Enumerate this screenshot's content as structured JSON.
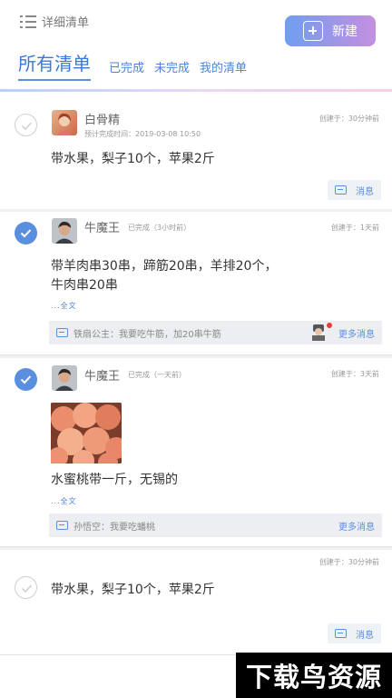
{
  "header": {
    "detail_label": "详细清单",
    "new_button_label": "新建",
    "tabs": [
      "所有清单",
      "已完成",
      "未完成",
      "我的清单"
    ]
  },
  "cards": [
    {
      "name": "白骨精",
      "status": "预计完成时间：2019-03-08 10:50",
      "created": "创建于：30分钟前",
      "content": "带水果，梨子10个，苹果2斤",
      "message_label": "消息",
      "checked": false
    },
    {
      "name": "牛魔王",
      "status": "已完成（3小时前）",
      "created": "创建于：1天前",
      "content_line1": "带羊肉串30串，蹄筋20串，羊排20个，",
      "content_line2": "牛肉串20串",
      "expand_label": "...全文",
      "message": "铁扇公主：我要吃牛筋，加20串牛筋",
      "more_messages_label": "更多消息",
      "checked": true
    },
    {
      "name": "牛魔王",
      "status": "已完成（一天前）",
      "created": "创建于：3天前",
      "content": "水蜜桃带一斤，无锡的",
      "expand_label": "...全文",
      "message": "孙悟空：我要吃蟠桃",
      "more_messages_label": "更多消息",
      "checked": true
    },
    {
      "created": "创建于：30分钟前",
      "content": "带水果，梨子10个，苹果2斤",
      "message_label": "消息",
      "checked": false
    }
  ],
  "watermark": "下载鸟资源",
  "colors": {
    "accent": "#5a8fe0",
    "gradient_start": "#6f9ef0",
    "gradient_end": "#c58fe0"
  }
}
